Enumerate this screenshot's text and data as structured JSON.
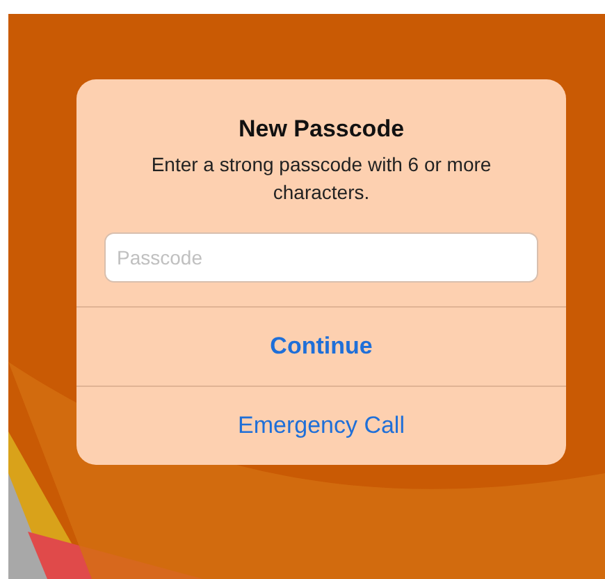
{
  "alert": {
    "title": "New Passcode",
    "message": "Enter a strong passcode with 6 or more characters.",
    "field": {
      "placeholder": "Passcode"
    },
    "actions": [
      {
        "label": "Continue",
        "preferred": true
      },
      {
        "label": "Emergency Call",
        "preferred": false
      }
    ]
  }
}
